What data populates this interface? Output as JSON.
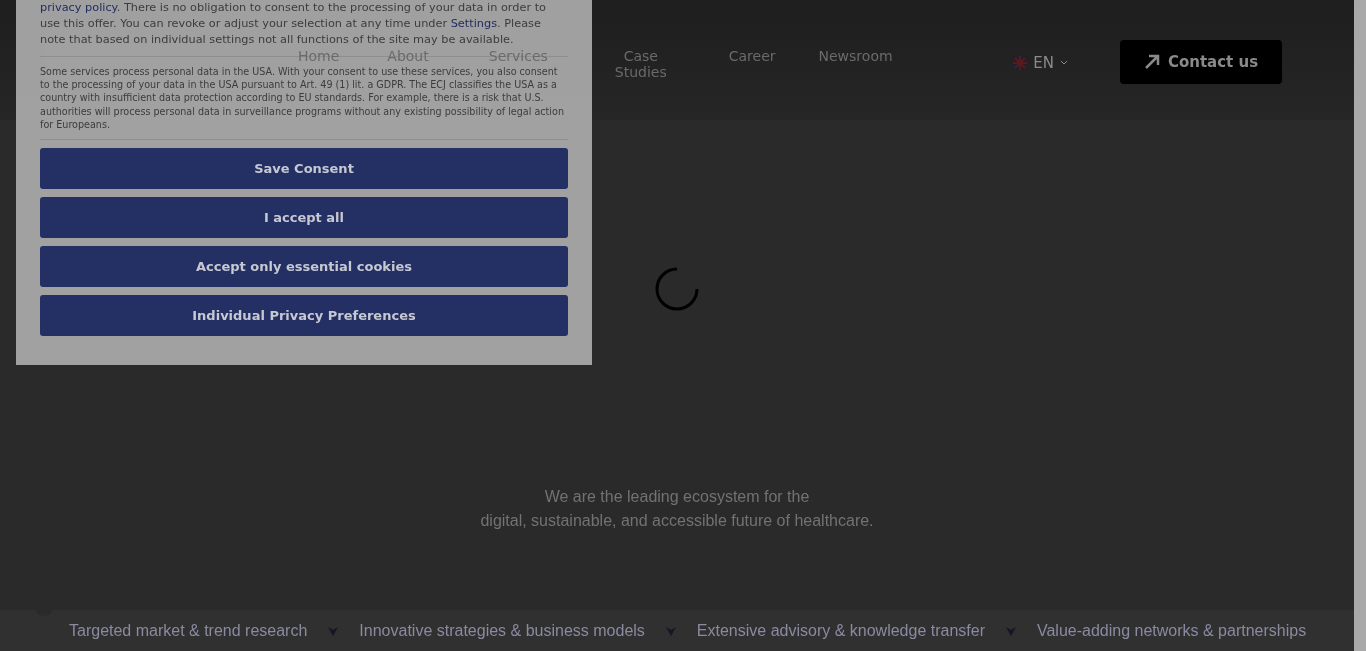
{
  "header": {
    "nav": [
      {
        "label": "Home"
      },
      {
        "label": "About"
      },
      {
        "label": "Services"
      },
      {
        "label": "Case Studies"
      },
      {
        "label": "Career"
      },
      {
        "label": "Newsroom"
      }
    ],
    "language": "EN",
    "contact_button": "Contact us"
  },
  "hero": {
    "lines": [
      "We are the leading ecosystem for the",
      "digital, sustainable, and accessible future of healthcare."
    ]
  },
  "ticker": [
    "Targeted market & trend research",
    "Innovative strategies & business models",
    "Extensive advisory & knowledge transfer",
    "Value-adding networks & partnerships"
  ],
  "consent_dialog": {
    "intro": [
      {
        "kind": "link",
        "text": "privacy policy"
      },
      {
        "kind": "text",
        "text": ". There is no obligation to consent to the processing of your data in order to use this offer. You can revoke or adjust your selection at any time under "
      },
      {
        "kind": "link",
        "text": "Settings"
      },
      {
        "kind": "text",
        "text": ". Please note that based on individual settings not all functions of the site may be available."
      }
    ],
    "usa_notice": "Some services process personal data in the USA. With your consent to use these services, you also consent to the processing of your data in the USA pursuant to Art. 49 (1) lit. a GDPR. The ECJ classifies the USA as a country with insufficient data protection according to EU standards. For example, there is a risk that U.S. authorities will process personal data in surveillance programs without any existing possibility of legal action for Europeans.",
    "buttons": [
      "Save Consent",
      "I accept all",
      "Accept only essential cookies",
      "Individual Privacy Preferences"
    ]
  }
}
